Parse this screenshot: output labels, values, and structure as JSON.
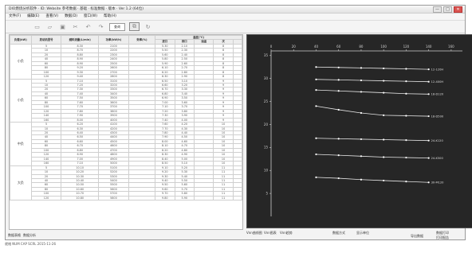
{
  "window": {
    "title": "DIO燃烧分析软件 · ID: Website 参考数据 · 基础 · 标准数据 · 版本 · Ver 1.2 (64位)",
    "buttons": [
      "—",
      "□",
      "✕"
    ]
  },
  "menu": [
    "文件(F)",
    "编辑(E)",
    "查看(V)",
    "数据(D)",
    "窗口(W)",
    "帮助(H)"
  ],
  "toolbar": {
    "icons": [
      "new-icon",
      "open-icon",
      "save-icon",
      "cut-icon",
      "undo-icon",
      "redo-icon",
      "refresh-icon"
    ],
    "button_label": "查询"
  },
  "table": {
    "headers": [
      "负载(kW)",
      "发动机型号",
      "燃料流量(L/min)",
      "功率(kW/h)",
      "效率(%)",
      "温度(°C)",
      "",
      "",
      "",
      ""
    ],
    "subheaders": [
      "进口",
      "排口",
      "油温",
      "次"
    ],
    "groups": [
      {
        "label": "小负",
        "rows": [
          [
            "12-120H",
            "5",
            "8.30",
            "2100",
            "5.30",
            "2.10",
            "8"
          ],
          [
            "12-200H",
            "10",
            "8.70",
            "2200",
            "5.50",
            "2.30",
            "8"
          ],
          [
            "12-300H",
            "20",
            "8.80",
            "2300",
            "5.60",
            "2.40",
            "8"
          ],
          [
            "12-400H",
            "40",
            "8.90",
            "2400",
            "5.80",
            "2.50",
            "8"
          ],
          [
            "12-500H",
            "60",
            "8.90",
            "2500",
            "5.90",
            "2.60",
            "8"
          ],
          [
            "12-600H",
            "80",
            "9.20",
            "2600",
            "6.10",
            "2.70",
            "8"
          ],
          [
            "12-700H",
            "100",
            "9.30",
            "2700",
            "6.20",
            "2.80",
            "8"
          ],
          [
            "12-800H",
            "120",
            "9.40",
            "2800",
            "6.30",
            "2.90",
            "8"
          ]
        ]
      },
      {
        "label": "小负",
        "rows": [
          [
            "18-D120",
            "5",
            "7.10",
            "3100",
            "6.50",
            "3.10",
            "9"
          ],
          [
            "18-D200",
            "10",
            "7.20",
            "3200",
            "6.60",
            "3.20",
            "9"
          ],
          [
            "18-D300",
            "20",
            "7.30",
            "3300",
            "6.70",
            "3.30",
            "9"
          ],
          [
            "18-D400",
            "40",
            "7.40",
            "3400",
            "6.80",
            "3.40",
            "9"
          ],
          [
            "18-D500",
            "60",
            "7.50",
            "3500",
            "6.90",
            "3.50",
            "9"
          ],
          [
            "18-D600",
            "80",
            "7.60",
            "3600",
            "7.00",
            "3.60",
            "9"
          ],
          [
            "18-D700",
            "100",
            "7.70",
            "3700",
            "7.10",
            "3.70",
            "9"
          ],
          [
            "18-D800",
            "120",
            "7.80",
            "3800",
            "7.20",
            "3.80",
            "9"
          ],
          [
            "18-D900",
            "140",
            "7.90",
            "3900",
            "7.30",
            "3.90",
            "9"
          ],
          [
            "18-D950",
            "160",
            "8.00",
            "4000",
            "7.40",
            "4.00",
            "9"
          ]
        ]
      },
      {
        "label": "中负",
        "rows": [
          [
            "24-K120",
            "5",
            "6.20",
            "4100",
            "7.60",
            "4.20",
            "10"
          ],
          [
            "24-K200",
            "10",
            "6.30",
            "4200",
            "7.70",
            "4.30",
            "10"
          ],
          [
            "24-K300",
            "20",
            "6.40",
            "4300",
            "7.80",
            "4.40",
            "10"
          ],
          [
            "24-K400",
            "40",
            "6.50",
            "4400",
            "7.90",
            "4.50",
            "10"
          ],
          [
            "24-K500",
            "60",
            "6.60",
            "4500",
            "8.00",
            "4.60",
            "10"
          ],
          [
            "24-K600",
            "80",
            "6.70",
            "4600",
            "8.10",
            "4.70",
            "10"
          ],
          [
            "24-K700",
            "100",
            "6.80",
            "4700",
            "8.20",
            "4.80",
            "10"
          ],
          [
            "24-K800",
            "120",
            "6.90",
            "4800",
            "8.30",
            "4.90",
            "10"
          ],
          [
            "24-K900",
            "140",
            "7.00",
            "4900",
            "8.40",
            "5.00",
            "10"
          ],
          [
            "24-K950",
            "160",
            "7.10",
            "5000",
            "8.50",
            "5.10",
            "10"
          ]
        ]
      },
      {
        "label": "大负",
        "rows": [
          [
            "30-M120",
            "5",
            "10.10",
            "5100",
            "9.10",
            "5.20",
            "11"
          ],
          [
            "30-M200",
            "10",
            "10.20",
            "5200",
            "9.20",
            "5.30",
            "11"
          ],
          [
            "30-M300",
            "20",
            "10.30",
            "5300",
            "9.30",
            "5.40",
            "11"
          ],
          [
            "30-M400",
            "40",
            "10.40",
            "5400",
            "9.40",
            "5.50",
            "11"
          ],
          [
            "30-M500",
            "60",
            "10.50",
            "5500",
            "9.50",
            "5.60",
            "11"
          ],
          [
            "30-M600",
            "80",
            "10.60",
            "5600",
            "9.60",
            "5.70",
            "11"
          ],
          [
            "30-M700",
            "100",
            "10.70",
            "5700",
            "9.70",
            "5.80",
            "11"
          ],
          [
            "30-M800",
            "120",
            "10.80",
            "5800",
            "9.80",
            "5.90",
            "11"
          ]
        ]
      }
    ]
  },
  "chart_data": {
    "type": "line",
    "x": [
      0,
      20,
      40,
      60,
      80,
      100,
      120,
      140,
      160
    ],
    "xlim": [
      0,
      170
    ],
    "ylim": [
      0,
      36
    ],
    "x_ticks": [
      "0",
      "20",
      "40",
      "60",
      "80",
      "100",
      "120",
      "140",
      "160"
    ],
    "y_ticks": [
      "35",
      "30",
      "25",
      "20",
      "15",
      "10",
      "5"
    ],
    "series": [
      {
        "name": "12-120H",
        "values": [
          32.5,
          32.4,
          32.3,
          32.2,
          32.1,
          32.0
        ]
      },
      {
        "name": "12-400H",
        "values": [
          29.8,
          29.7,
          29.6,
          29.5,
          29.4,
          29.3
        ]
      },
      {
        "name": "18-D120",
        "values": [
          27.5,
          27.3,
          27.1,
          26.9,
          26.7,
          26.6
        ]
      },
      {
        "name": "18-D500",
        "values": [
          24.0,
          23.2,
          22.5,
          22.0,
          21.9,
          21.8
        ]
      },
      {
        "name": "24-K120",
        "values": [
          17.0,
          16.9,
          16.8,
          16.7,
          16.6,
          16.5
        ]
      },
      {
        "name": "24-K500",
        "values": [
          13.5,
          13.3,
          13.1,
          12.9,
          12.8,
          12.7
        ]
      },
      {
        "name": "30-M120",
        "values": [
          8.5,
          8.3,
          8.0,
          7.8,
          7.6,
          7.4
        ]
      }
    ]
  },
  "chart_tabs": [
    "Vnn曲线图",
    "Vnn图表",
    "Vnn趋势"
  ],
  "bottom": {
    "left_tabs": [
      "数据表格",
      "数据分析"
    ],
    "mid_label_1": "数据方式",
    "mid_label_2": "显示单位",
    "btn_export": "导出数据",
    "btn_print_1": "数据打印",
    "btn_print_2": "打印报告"
  },
  "status": "就绪  NUM  CAP  SCRL  2015-11-26"
}
